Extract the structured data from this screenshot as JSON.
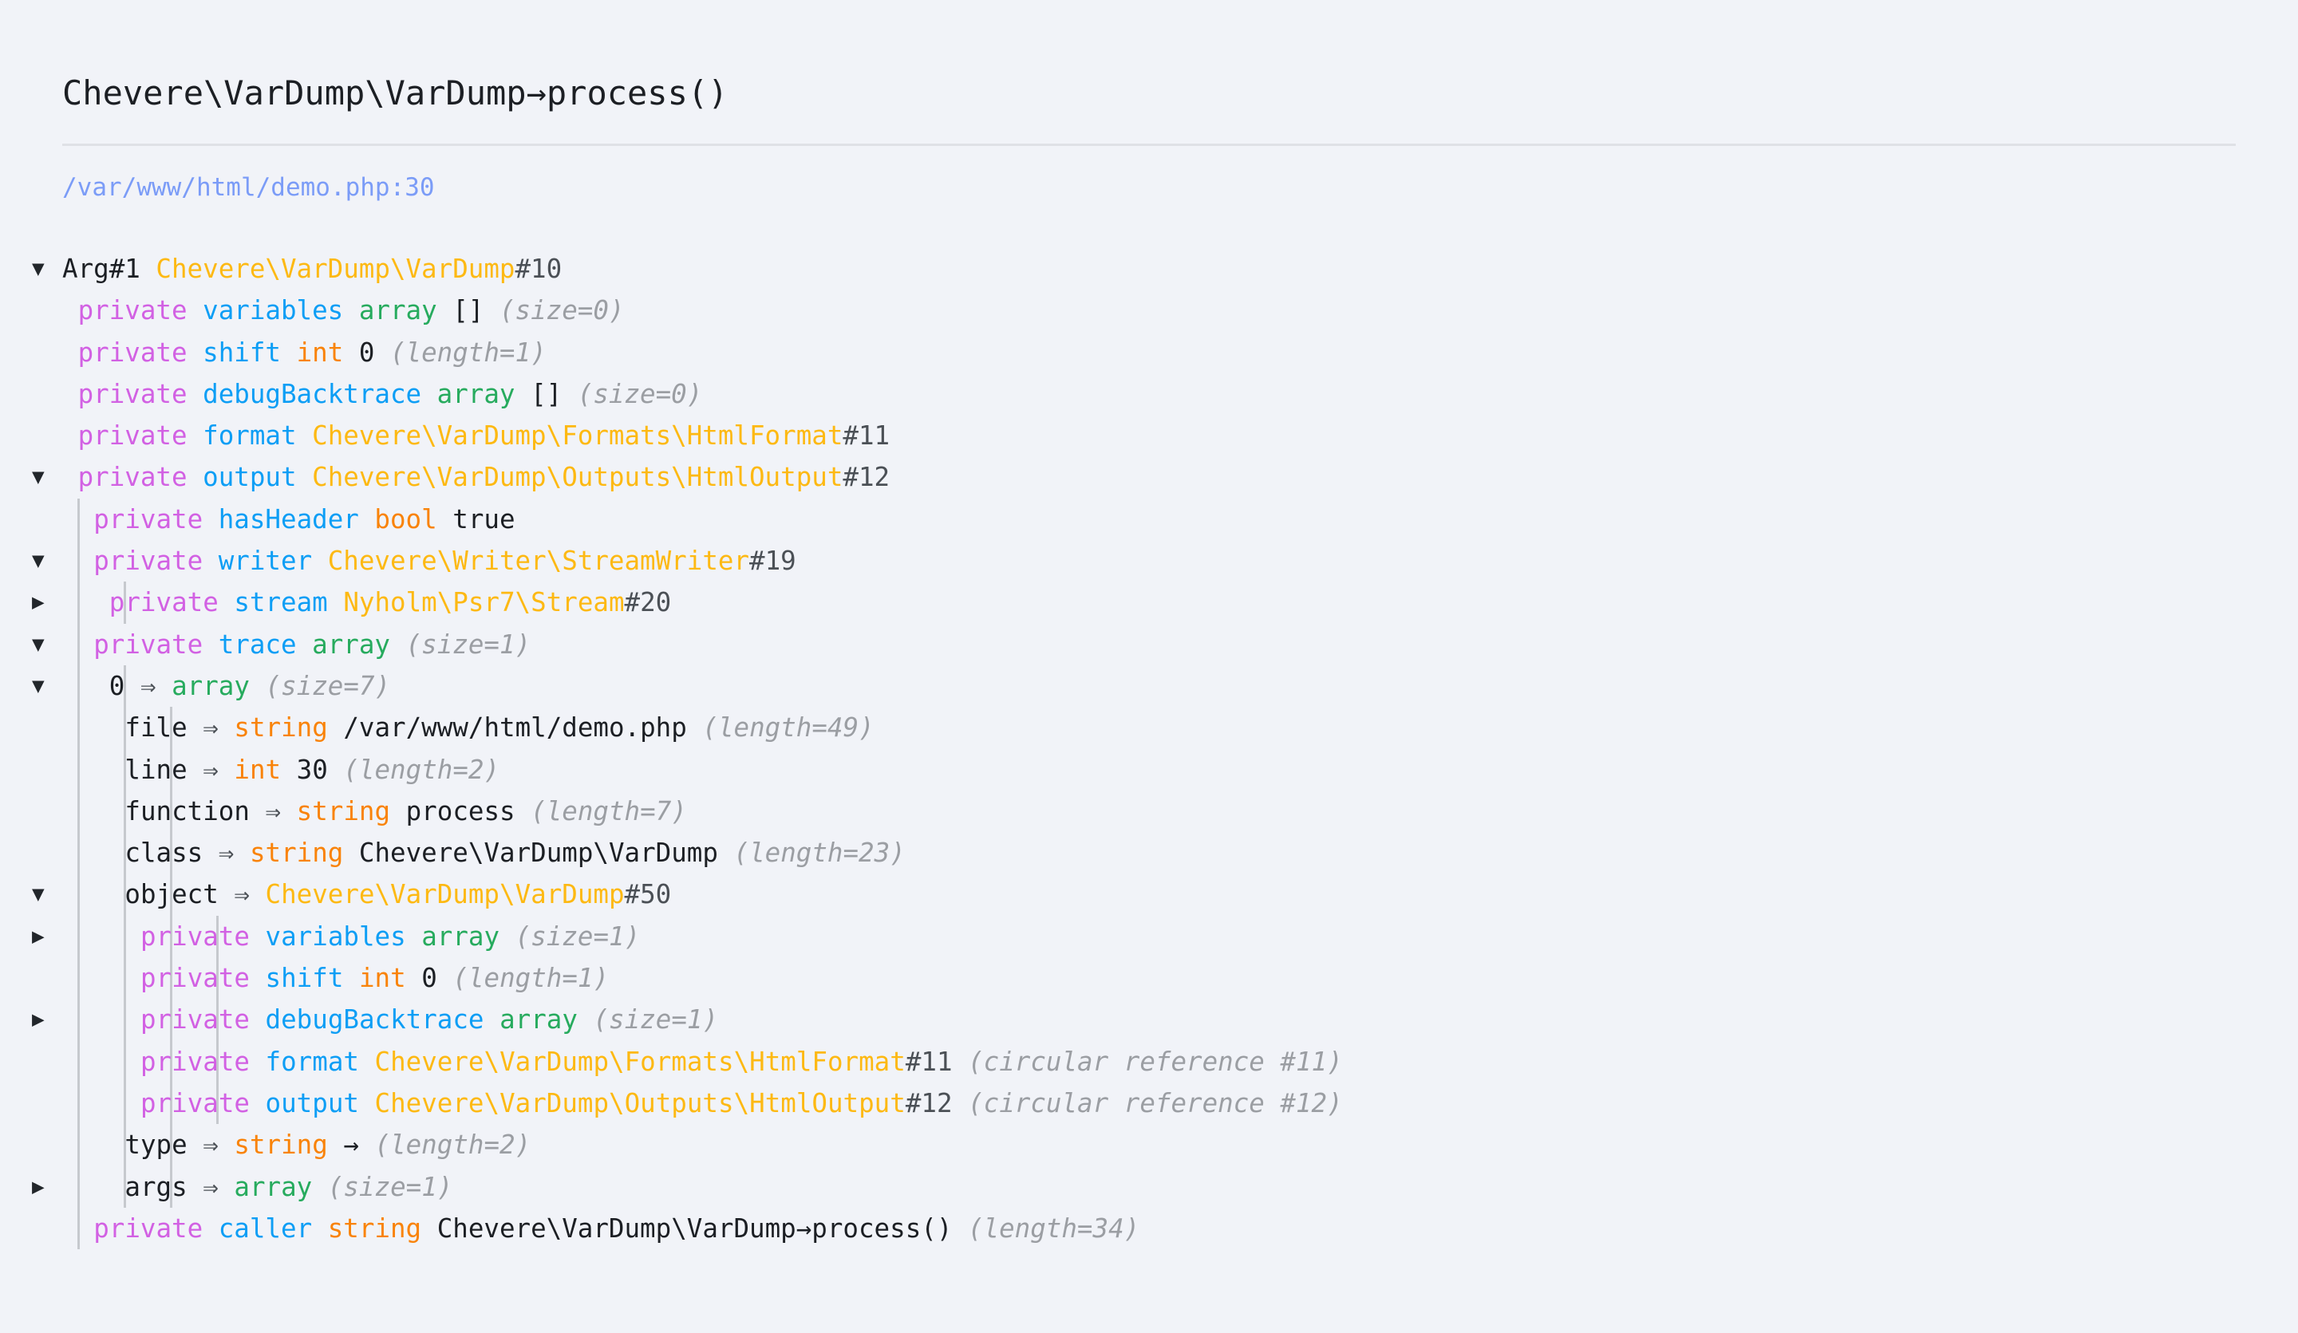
{
  "header": {
    "title": "Chevere\\VarDump\\VarDump→process()",
    "file": "/var/www/html/demo.php:30"
  },
  "colors": {
    "background": "#f1f3f8",
    "modifier": "#d261e3",
    "property_name": "#0d9ef5",
    "array": "#27ab5e",
    "scalar_type": "#f98309",
    "class_name": "#fdb913",
    "object_id": "#4b5056",
    "meta": "#9b9ea3",
    "file_link": "#7b9cf7",
    "guide_line": "#c6c9ce",
    "text": "#1c1f24"
  },
  "glyphs": {
    "caret_open": "▼",
    "caret_closed": "▶",
    "double_arrow": "⇒",
    "single_arrow": "→"
  },
  "tree": [
    {
      "caret": "open",
      "indent": 0,
      "guides": [],
      "tokens": [
        {
          "cls": "t-val",
          "text": "Arg#1"
        },
        {
          "cls": "t-val",
          "text": " "
        },
        {
          "cls": "t-class",
          "text": "Chevere\\VarDump\\VarDump"
        },
        {
          "cls": "t-id",
          "text": "#10"
        }
      ]
    },
    {
      "caret": "none",
      "indent": 1,
      "guides": [],
      "tokens": [
        {
          "cls": "t-mod",
          "text": "private"
        },
        {
          "cls": "t-val",
          "text": " "
        },
        {
          "cls": "t-name",
          "text": "variables"
        },
        {
          "cls": "t-val",
          "text": " "
        },
        {
          "cls": "t-array",
          "text": "array"
        },
        {
          "cls": "t-val",
          "text": " [] "
        },
        {
          "cls": "t-meta",
          "text": "(size=0)"
        }
      ]
    },
    {
      "caret": "none",
      "indent": 1,
      "guides": [],
      "tokens": [
        {
          "cls": "t-mod",
          "text": "private"
        },
        {
          "cls": "t-val",
          "text": " "
        },
        {
          "cls": "t-name",
          "text": "shift"
        },
        {
          "cls": "t-val",
          "text": " "
        },
        {
          "cls": "t-type",
          "text": "int"
        },
        {
          "cls": "t-val",
          "text": " 0 "
        },
        {
          "cls": "t-meta",
          "text": "(length=1)"
        }
      ]
    },
    {
      "caret": "none",
      "indent": 1,
      "guides": [],
      "tokens": [
        {
          "cls": "t-mod",
          "text": "private"
        },
        {
          "cls": "t-val",
          "text": " "
        },
        {
          "cls": "t-name",
          "text": "debugBacktrace"
        },
        {
          "cls": "t-val",
          "text": " "
        },
        {
          "cls": "t-array",
          "text": "array"
        },
        {
          "cls": "t-val",
          "text": " [] "
        },
        {
          "cls": "t-meta",
          "text": "(size=0)"
        }
      ]
    },
    {
      "caret": "none",
      "indent": 1,
      "guides": [],
      "tokens": [
        {
          "cls": "t-mod",
          "text": "private"
        },
        {
          "cls": "t-val",
          "text": " "
        },
        {
          "cls": "t-name",
          "text": "format"
        },
        {
          "cls": "t-val",
          "text": " "
        },
        {
          "cls": "t-class",
          "text": "Chevere\\VarDump\\Formats\\HtmlFormat"
        },
        {
          "cls": "t-id",
          "text": "#11"
        }
      ]
    },
    {
      "caret": "open",
      "indent": 1,
      "guides": [],
      "tokens": [
        {
          "cls": "t-mod",
          "text": "private"
        },
        {
          "cls": "t-val",
          "text": " "
        },
        {
          "cls": "t-name",
          "text": "output"
        },
        {
          "cls": "t-val",
          "text": " "
        },
        {
          "cls": "t-class",
          "text": "Chevere\\VarDump\\Outputs\\HtmlOutput"
        },
        {
          "cls": "t-id",
          "text": "#12"
        }
      ]
    },
    {
      "caret": "none",
      "indent": 2,
      "guides": [
        1
      ],
      "tokens": [
        {
          "cls": "t-mod",
          "text": "private"
        },
        {
          "cls": "t-val",
          "text": " "
        },
        {
          "cls": "t-name",
          "text": "hasHeader"
        },
        {
          "cls": "t-val",
          "text": " "
        },
        {
          "cls": "t-type",
          "text": "bool"
        },
        {
          "cls": "t-val",
          "text": " true"
        }
      ]
    },
    {
      "caret": "open",
      "indent": 2,
      "guides": [
        1
      ],
      "tokens": [
        {
          "cls": "t-mod",
          "text": "private"
        },
        {
          "cls": "t-val",
          "text": " "
        },
        {
          "cls": "t-name",
          "text": "writer"
        },
        {
          "cls": "t-val",
          "text": " "
        },
        {
          "cls": "t-class",
          "text": "Chevere\\Writer\\StreamWriter"
        },
        {
          "cls": "t-id",
          "text": "#19"
        }
      ]
    },
    {
      "caret": "closed",
      "indent": 3,
      "guides": [
        1,
        2
      ],
      "tokens": [
        {
          "cls": "t-mod",
          "text": "private"
        },
        {
          "cls": "t-val",
          "text": " "
        },
        {
          "cls": "t-name",
          "text": "stream"
        },
        {
          "cls": "t-val",
          "text": " "
        },
        {
          "cls": "t-class",
          "text": "Nyholm\\Psr7\\Stream"
        },
        {
          "cls": "t-id",
          "text": "#20"
        }
      ]
    },
    {
      "caret": "open",
      "indent": 2,
      "guides": [
        1
      ],
      "tokens": [
        {
          "cls": "t-mod",
          "text": "private"
        },
        {
          "cls": "t-val",
          "text": " "
        },
        {
          "cls": "t-name",
          "text": "trace"
        },
        {
          "cls": "t-val",
          "text": " "
        },
        {
          "cls": "t-array",
          "text": "array"
        },
        {
          "cls": "t-val",
          "text": " "
        },
        {
          "cls": "t-meta",
          "text": "(size=1)"
        }
      ]
    },
    {
      "caret": "open",
      "indent": 3,
      "guides": [
        1,
        2
      ],
      "tokens": [
        {
          "cls": "t-key",
          "text": "0"
        },
        {
          "cls": "t-arrow",
          "text": " ⇒ "
        },
        {
          "cls": "t-array",
          "text": "array"
        },
        {
          "cls": "t-val",
          "text": " "
        },
        {
          "cls": "t-meta",
          "text": "(size=7)"
        }
      ]
    },
    {
      "caret": "none",
      "indent": 4,
      "guides": [
        1,
        2,
        3
      ],
      "tokens": [
        {
          "cls": "t-key",
          "text": "file"
        },
        {
          "cls": "t-arrow",
          "text": " ⇒ "
        },
        {
          "cls": "t-type",
          "text": "string"
        },
        {
          "cls": "t-val",
          "text": " /var/www/html/demo.php "
        },
        {
          "cls": "t-meta",
          "text": "(length=49)"
        }
      ]
    },
    {
      "caret": "none",
      "indent": 4,
      "guides": [
        1,
        2,
        3
      ],
      "tokens": [
        {
          "cls": "t-key",
          "text": "line"
        },
        {
          "cls": "t-arrow",
          "text": " ⇒ "
        },
        {
          "cls": "t-type",
          "text": "int"
        },
        {
          "cls": "t-val",
          "text": " 30 "
        },
        {
          "cls": "t-meta",
          "text": "(length=2)"
        }
      ]
    },
    {
      "caret": "none",
      "indent": 4,
      "guides": [
        1,
        2,
        3
      ],
      "tokens": [
        {
          "cls": "t-key",
          "text": "function"
        },
        {
          "cls": "t-arrow",
          "text": " ⇒ "
        },
        {
          "cls": "t-type",
          "text": "string"
        },
        {
          "cls": "t-val",
          "text": " process "
        },
        {
          "cls": "t-meta",
          "text": "(length=7)"
        }
      ]
    },
    {
      "caret": "none",
      "indent": 4,
      "guides": [
        1,
        2,
        3
      ],
      "tokens": [
        {
          "cls": "t-key",
          "text": "class"
        },
        {
          "cls": "t-arrow",
          "text": " ⇒ "
        },
        {
          "cls": "t-type",
          "text": "string"
        },
        {
          "cls": "t-val",
          "text": " Chevere\\VarDump\\VarDump "
        },
        {
          "cls": "t-meta",
          "text": "(length=23)"
        }
      ]
    },
    {
      "caret": "open",
      "indent": 4,
      "guides": [
        1,
        2,
        3
      ],
      "tokens": [
        {
          "cls": "t-key",
          "text": "object"
        },
        {
          "cls": "t-arrow",
          "text": " ⇒ "
        },
        {
          "cls": "t-class",
          "text": "Chevere\\VarDump\\VarDump"
        },
        {
          "cls": "t-id",
          "text": "#50"
        }
      ]
    },
    {
      "caret": "closed",
      "indent": 5,
      "guides": [
        1,
        2,
        3,
        4
      ],
      "tokens": [
        {
          "cls": "t-mod",
          "text": "private"
        },
        {
          "cls": "t-val",
          "text": " "
        },
        {
          "cls": "t-name",
          "text": "variables"
        },
        {
          "cls": "t-val",
          "text": " "
        },
        {
          "cls": "t-array",
          "text": "array"
        },
        {
          "cls": "t-val",
          "text": " "
        },
        {
          "cls": "t-meta",
          "text": "(size=1)"
        }
      ]
    },
    {
      "caret": "none",
      "indent": 5,
      "guides": [
        1,
        2,
        3,
        4
      ],
      "tokens": [
        {
          "cls": "t-mod",
          "text": "private"
        },
        {
          "cls": "t-val",
          "text": " "
        },
        {
          "cls": "t-name",
          "text": "shift"
        },
        {
          "cls": "t-val",
          "text": " "
        },
        {
          "cls": "t-type",
          "text": "int"
        },
        {
          "cls": "t-val",
          "text": " 0 "
        },
        {
          "cls": "t-meta",
          "text": "(length=1)"
        }
      ]
    },
    {
      "caret": "closed",
      "indent": 5,
      "guides": [
        1,
        2,
        3,
        4
      ],
      "tokens": [
        {
          "cls": "t-mod",
          "text": "private"
        },
        {
          "cls": "t-val",
          "text": " "
        },
        {
          "cls": "t-name",
          "text": "debugBacktrace"
        },
        {
          "cls": "t-val",
          "text": " "
        },
        {
          "cls": "t-array",
          "text": "array"
        },
        {
          "cls": "t-val",
          "text": " "
        },
        {
          "cls": "t-meta",
          "text": "(size=1)"
        }
      ]
    },
    {
      "caret": "none",
      "indent": 5,
      "guides": [
        1,
        2,
        3,
        4
      ],
      "tokens": [
        {
          "cls": "t-mod",
          "text": "private"
        },
        {
          "cls": "t-val",
          "text": " "
        },
        {
          "cls": "t-name",
          "text": "format"
        },
        {
          "cls": "t-val",
          "text": " "
        },
        {
          "cls": "t-class",
          "text": "Chevere\\VarDump\\Formats\\HtmlFormat"
        },
        {
          "cls": "t-id",
          "text": "#11"
        },
        {
          "cls": "t-val",
          "text": " "
        },
        {
          "cls": "t-meta",
          "text": "(circular reference #11)"
        }
      ]
    },
    {
      "caret": "none",
      "indent": 5,
      "guides": [
        1,
        2,
        3,
        4
      ],
      "tokens": [
        {
          "cls": "t-mod",
          "text": "private"
        },
        {
          "cls": "t-val",
          "text": " "
        },
        {
          "cls": "t-name",
          "text": "output"
        },
        {
          "cls": "t-val",
          "text": " "
        },
        {
          "cls": "t-class",
          "text": "Chevere\\VarDump\\Outputs\\HtmlOutput"
        },
        {
          "cls": "t-id",
          "text": "#12"
        },
        {
          "cls": "t-val",
          "text": " "
        },
        {
          "cls": "t-meta",
          "text": "(circular reference #12)"
        }
      ]
    },
    {
      "caret": "none",
      "indent": 4,
      "guides": [
        1,
        2,
        3
      ],
      "tokens": [
        {
          "cls": "t-key",
          "text": "type"
        },
        {
          "cls": "t-arrow",
          "text": " ⇒ "
        },
        {
          "cls": "t-type",
          "text": "string"
        },
        {
          "cls": "t-val",
          "text": " → "
        },
        {
          "cls": "t-meta",
          "text": "(length=2)"
        }
      ]
    },
    {
      "caret": "closed",
      "indent": 4,
      "guides": [
        1,
        2,
        3
      ],
      "tokens": [
        {
          "cls": "t-key",
          "text": "args"
        },
        {
          "cls": "t-arrow",
          "text": " ⇒ "
        },
        {
          "cls": "t-array",
          "text": "array"
        },
        {
          "cls": "t-val",
          "text": " "
        },
        {
          "cls": "t-meta",
          "text": "(size=1)"
        }
      ]
    },
    {
      "caret": "none",
      "indent": 2,
      "guides": [
        1
      ],
      "tokens": [
        {
          "cls": "t-mod",
          "text": "private"
        },
        {
          "cls": "t-val",
          "text": " "
        },
        {
          "cls": "t-name",
          "text": "caller"
        },
        {
          "cls": "t-val",
          "text": " "
        },
        {
          "cls": "t-type",
          "text": "string"
        },
        {
          "cls": "t-val",
          "text": " Chevere\\VarDump\\VarDump→process() "
        },
        {
          "cls": "t-meta",
          "text": "(length=34)"
        }
      ]
    }
  ]
}
